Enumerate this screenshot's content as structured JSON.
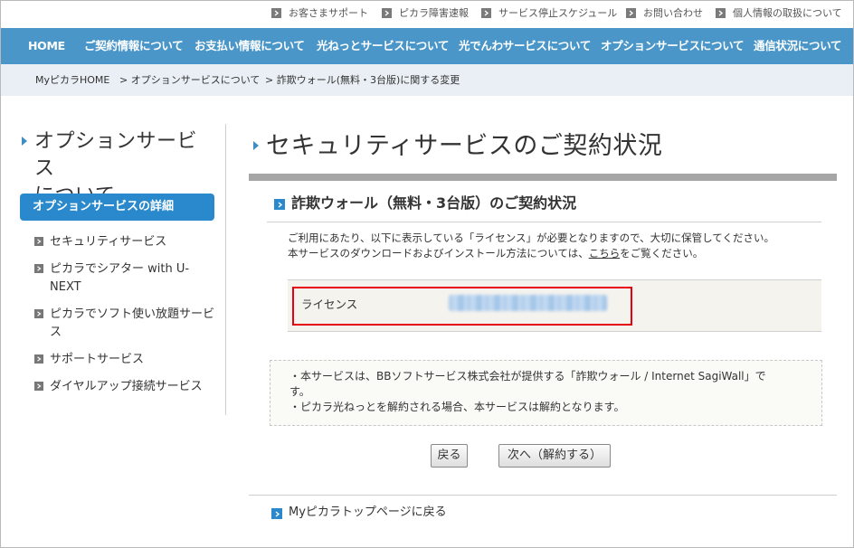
{
  "utility_links": [
    "お客さまサポート",
    "ピカラ障害速報",
    "サービス停止スケジュール",
    "お問い合わせ",
    "個人情報の取扱について"
  ],
  "nav": [
    "HOME",
    "ご契約情報について",
    "お支払い情報について",
    "光ねっとサービスについて",
    "光でんわサービスについて",
    "オプションサービスについて",
    "通信状況について"
  ],
  "breadcrumb": [
    "MyピカラHOME",
    "> オプションサービスについて",
    "> 詐欺ウォール(無料・3台版)に関する変更"
  ],
  "sidebar": {
    "title_line1": "オプションサービス",
    "title_line2": "について",
    "heading": "オプションサービスの詳細",
    "links": [
      [
        "セキュリティサービス"
      ],
      [
        "ピカラでシアター with U-",
        "NEXT"
      ],
      [
        "ピカラでソフト使い放題サービ",
        "ス"
      ],
      [
        "サポートサービス"
      ],
      [
        "ダイヤルアップ接続サービス"
      ]
    ]
  },
  "main": {
    "title": "セキュリティサービスのご契約状況",
    "section_title": "詐欺ウォール（無料・3台版）のご契約状況",
    "desc_line1": "ご利用にあたり、以下に表示している「ライセンス」が必要となりますので、大切に保管してください。",
    "desc_line2_pre": "本サービスのダウンロードおよびインストール方法については、",
    "desc_line2_link": "こちら",
    "desc_line2_post": "をご覧ください。",
    "license_label": "ライセンス",
    "notes": [
      "・本サービスは、BBソフトサービス株式会社が提供する「詐欺ウォール / Internet SagiWall」で",
      "す。",
      "・ピカラ光ねっとを解約される場合、本サービスは解約となります。"
    ],
    "back_button": "戻る",
    "next_button": "次へ（解約する）",
    "footer_link": "Myピカラトップページに戻る"
  },
  "colors": {
    "nav_bg": "#4a96c8",
    "breadcrumb_bg": "#e9eff5",
    "accent": "#2a88cc",
    "highlight": "#e60012"
  }
}
